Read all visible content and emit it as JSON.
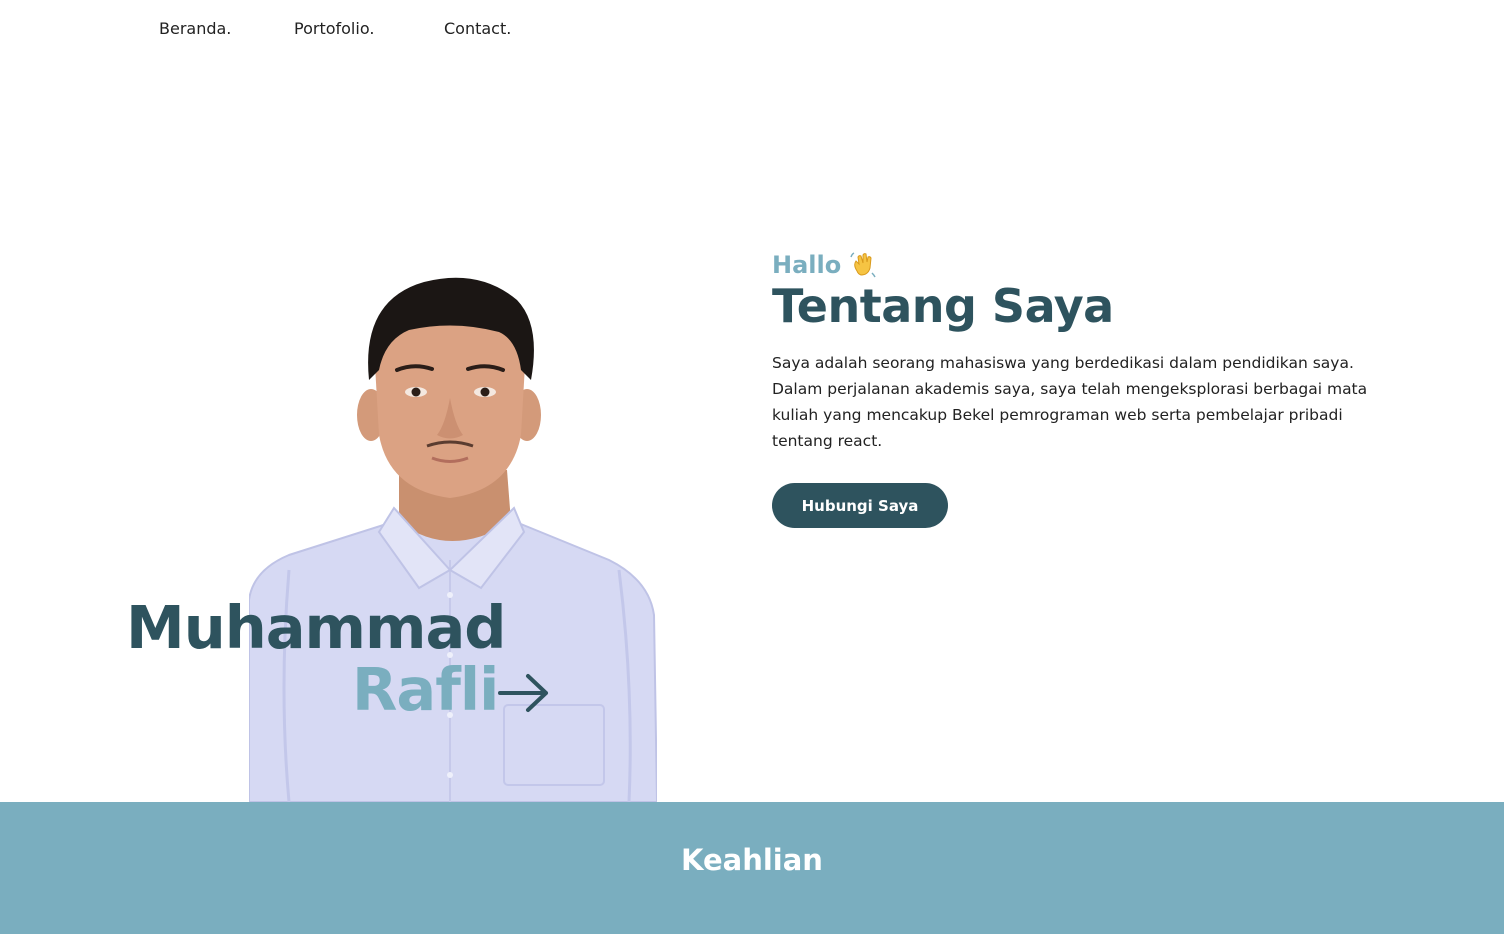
{
  "nav": {
    "items": [
      {
        "label": "Beranda."
      },
      {
        "label": "Portofolio."
      },
      {
        "label": "Contact."
      }
    ]
  },
  "hero": {
    "first_name": "Muhammad",
    "last_name": "Rafli",
    "arrow_icon": "arrow-right-icon",
    "photo_alt": "Foto Muhammad Rafli"
  },
  "about": {
    "greeting": "Hallo",
    "greeting_icon": "waving-hand-icon",
    "title": "Tentang Saya",
    "description": "Saya adalah seorang mahasiswa yang berdedikasi dalam pendidikan saya. Dalam perjalanan akademis saya, saya telah mengeksplorasi berbagai mata kuliah yang mencakup Bekel pemrograman web serta pembelajar pribadi tentang react.",
    "cta_label": "Hubungi Saya"
  },
  "skills": {
    "title": "Keahlian"
  },
  "colors": {
    "primary": "#2e535e",
    "accent": "#7aaebf",
    "background": "#ffffff"
  }
}
